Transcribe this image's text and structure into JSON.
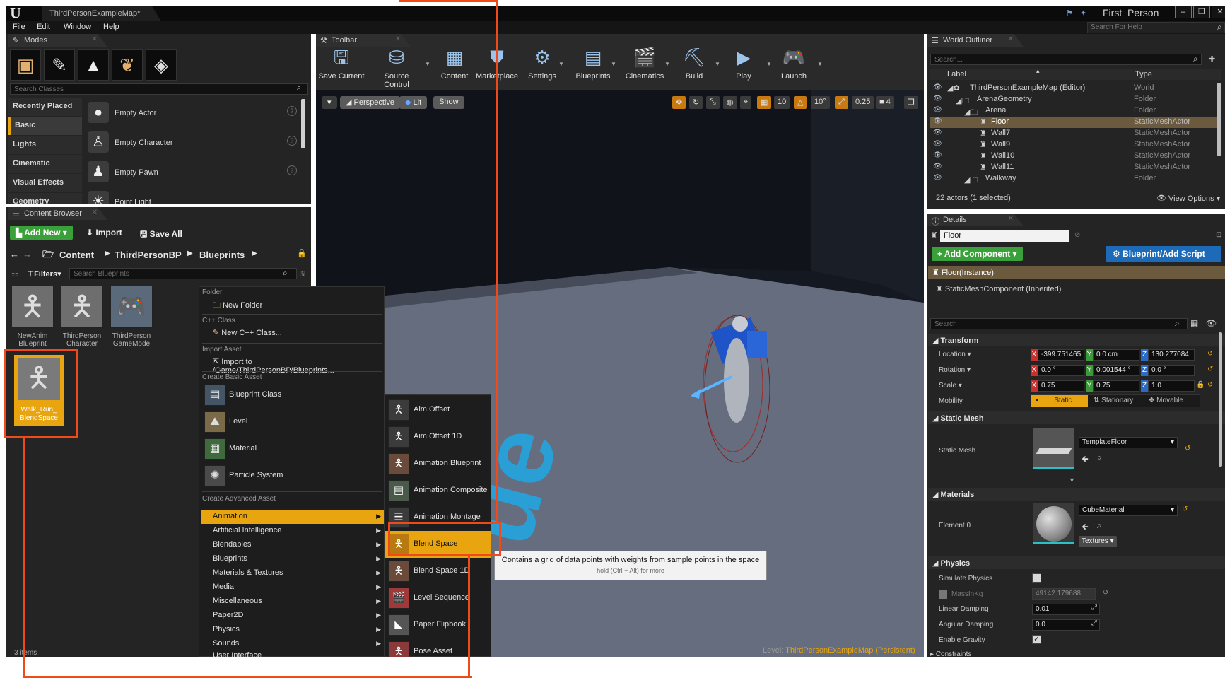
{
  "window": {
    "doc_tab": "ThirdPersonExampleMap*",
    "project_name": "First_Person",
    "search_help_placeholder": "Search For Help"
  },
  "menu": [
    "File",
    "Edit",
    "Window",
    "Help"
  ],
  "modes": {
    "tab": "Modes",
    "search_placeholder": "Search Classes",
    "categories": [
      "Recently Placed",
      "Basic",
      "Lights",
      "Cinematic",
      "Visual Effects",
      "Geometry"
    ],
    "placed_items": [
      "Empty Actor",
      "Empty Character",
      "Empty Pawn",
      "Point Light"
    ]
  },
  "content_browser": {
    "tab": "Content Browser",
    "add_new": "Add New",
    "import": "Import",
    "save_all": "Save All",
    "breadcrumb": [
      "Content",
      "ThirdPersonBP",
      "Blueprints"
    ],
    "filters": "Filters",
    "search_placeholder": "Search Blueprints",
    "assets": [
      {
        "label": "NewAnim Blueprint"
      },
      {
        "label": "ThirdPerson Character"
      },
      {
        "label": "ThirdPerson GameMode"
      },
      {
        "label": "Walk_Run_ BlendSpace"
      }
    ],
    "item_count": "3 items"
  },
  "toolbar": {
    "tab": "Toolbar",
    "buttons": [
      "Save Current",
      "Source Control",
      "Content",
      "Marketplace",
      "Settings",
      "Blueprints",
      "Cinematics",
      "Build",
      "Play",
      "Launch"
    ]
  },
  "viewport": {
    "perspective": "Perspective",
    "lit": "Lit",
    "show": "Show",
    "grid_snap": "10",
    "rot_snap": "10°",
    "scale_snap": "0.25",
    "cam_speed": "4",
    "level_label": "Level:",
    "level_name": "ThirdPersonExampleMap (Persistent)"
  },
  "context_menu": {
    "folder_hdr": "Folder",
    "new_folder": "New Folder",
    "cpp_hdr": "C++ Class",
    "new_cpp": "New C++ Class...",
    "import_hdr": "Import Asset",
    "import_to": "Import to /Game/ThirdPersonBP/Blueprints...",
    "basic_hdr": "Create Basic Asset",
    "basic": [
      "Blueprint Class",
      "Level",
      "Material",
      "Particle System"
    ],
    "advanced_hdr": "Create Advanced Asset",
    "advanced": [
      "Animation",
      "Artificial Intelligence",
      "Blendables",
      "Blueprints",
      "Materials & Textures",
      "Media",
      "Miscellaneous",
      "Paper2D",
      "Physics",
      "Sounds",
      "User Interface"
    ]
  },
  "animation_submenu": [
    "Aim Offset",
    "Aim Offset 1D",
    "Animation Blueprint",
    "Animation Composite",
    "Animation Montage",
    "Blend Space",
    "Blend Space 1D",
    "Level Sequence",
    "Paper Flipbook",
    "Pose Asset"
  ],
  "tooltip": {
    "main": "Contains a grid of data points with weights from sample points in the space",
    "hint": "hold (Ctrl + Alt) for more"
  },
  "world_outliner": {
    "tab": "World Outliner",
    "search_placeholder": "Search...",
    "col_label": "Label",
    "col_type": "Type",
    "rows": [
      {
        "label": "ThirdPersonExampleMap (Editor)",
        "type": "World"
      },
      {
        "label": "ArenaGeometry",
        "type": "Folder"
      },
      {
        "label": "Arena",
        "type": "Folder"
      },
      {
        "label": "Floor",
        "type": "StaticMeshActor"
      },
      {
        "label": "Wall7",
        "type": "StaticMeshActor"
      },
      {
        "label": "Wall9",
        "type": "StaticMeshActor"
      },
      {
        "label": "Wall10",
        "type": "StaticMeshActor"
      },
      {
        "label": "Wall11",
        "type": "StaticMeshActor"
      },
      {
        "label": "Walkway",
        "type": "Folder"
      }
    ],
    "actor_count": "22 actors (1 selected)",
    "view_options": "View Options"
  },
  "details": {
    "tab": "Details",
    "name": "Floor",
    "add_component": "+ Add Component",
    "blueprint_script": "Blueprint/Add Script",
    "instance": "Floor(Instance)",
    "component": "StaticMeshComponent (Inherited)",
    "search_placeholder": "Search",
    "transform": "Transform",
    "location_label": "Location",
    "location": [
      "-399.751465",
      "0.0 cm",
      "130.277084"
    ],
    "rotation_label": "Rotation",
    "rotation": [
      "0.0 °",
      "0.001544 °",
      "0.0 °"
    ],
    "scale_label": "Scale",
    "scale": [
      "0.75",
      "0.75",
      "1.0"
    ],
    "mobility_label": "Mobility",
    "mobility": [
      "Static",
      "Stationary",
      "Movable"
    ],
    "static_mesh_hdr": "Static Mesh",
    "static_mesh_label": "Static Mesh",
    "static_mesh_value": "TemplateFloor",
    "materials_hdr": "Materials",
    "element0_label": "Element 0",
    "element0_value": "CubeMaterial",
    "textures": "Textures",
    "physics_hdr": "Physics",
    "simulate_physics": "Simulate Physics",
    "mass_label": "MassInKg",
    "mass_value": "49142.179688",
    "linear_damping_label": "Linear Damping",
    "linear_damping": "0.01",
    "angular_damping_label": "Angular Damping",
    "angular_damping": "0.0",
    "enable_gravity": "Enable Gravity",
    "constraints": "Constraints"
  },
  "colors": {
    "highlight": "#e8a50f",
    "annotation": "#f04a1a",
    "selection": "#6c5a3e"
  }
}
